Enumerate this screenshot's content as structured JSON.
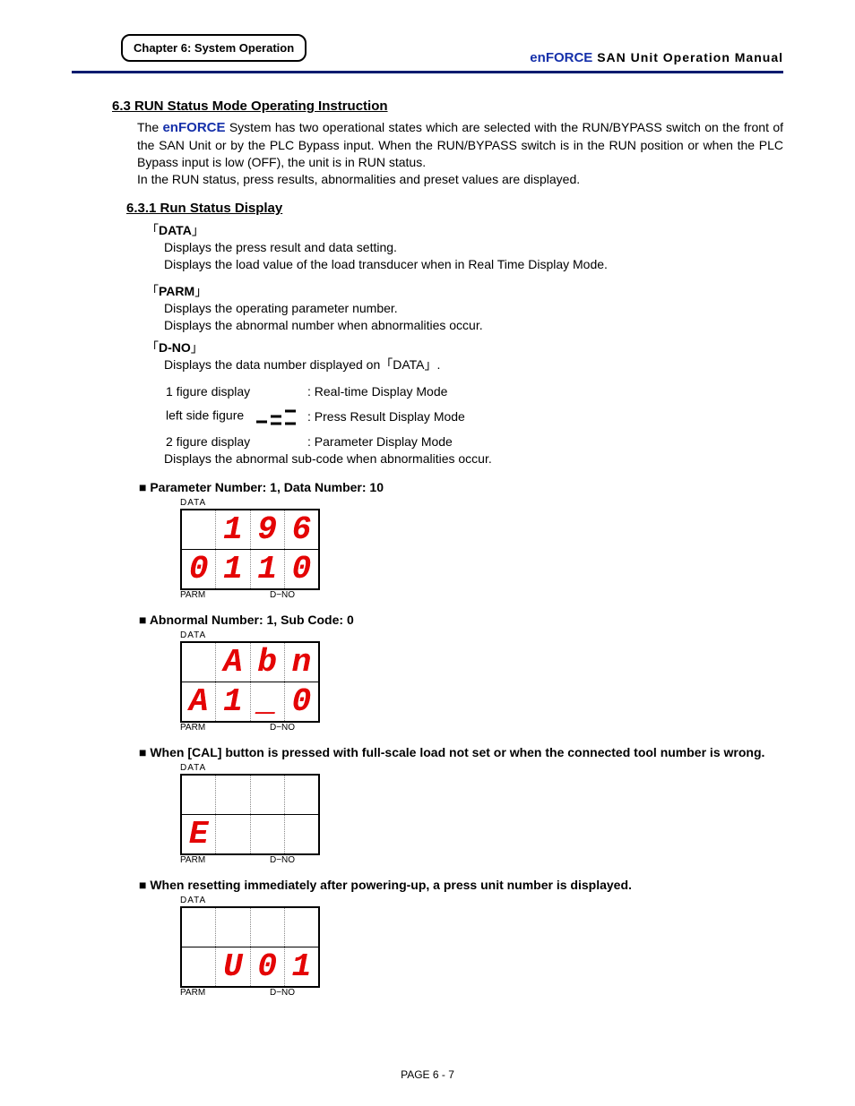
{
  "header": {
    "chapter": "Chapter 6: System Operation",
    "brand_lower": "en",
    "brand_upper": "FORCE",
    "manual": " SAN  Unit  Operation  Manual"
  },
  "section": {
    "h63": "6.3    RUN Status Mode Operating Instruction",
    "para1_a": "The ",
    "para1_b": " System has two operational states which are selected with the RUN/BYPASS switch on the front of the SAN Unit or by the PLC Bypass input. When the RUN/BYPASS switch is in the RUN position or when the PLC Bypass input is low (OFF), the unit is in RUN status.",
    "para1_c": "In the RUN status, press results, abnormalities and preset values are displayed.",
    "h631": "6.3.1    Run Status Display",
    "lbracket": "「",
    "rbracket": "」",
    "data_lbl": "DATA",
    "data_d1": "Displays the press result and data setting.",
    "data_d2": "Displays the load value of the load transducer when in Real Time Display Mode.",
    "parm_lbl": "PARM",
    "parm_d1": "Displays the operating parameter number.",
    "parm_d2": "Displays the abnormal number when abnormalities occur.",
    "dno_lbl": "D-NO",
    "dno_d1": "Displays the data number displayed on「DATA」.",
    "t1a": "1 figure display",
    "t1b": ": Real-time Display Mode",
    "t2a": "left side figure",
    "t2b": ": Press Result Display Mode",
    "t3a": "2 figure display",
    "t3b": ": Parameter Display Mode",
    "dno_d2": "Displays the abnormal sub-code when abnormalities occur."
  },
  "displays": {
    "label_data": "DATA",
    "label_parm": "PARM",
    "label_dno": "D−NO",
    "b1": "■ Parameter Number: 1, Data Number: 10",
    "d1_top": [
      "",
      "1",
      "9",
      "6"
    ],
    "d1_bot": [
      "0",
      "1",
      "1",
      "0"
    ],
    "b2": "■ Abnormal Number: 1, Sub Code: 0",
    "d2_top": [
      "",
      "A",
      "b",
      "n"
    ],
    "d2_bot": [
      "A",
      "1",
      "_",
      "0"
    ],
    "b3": "■ When [CAL] button is pressed with full-scale load not set or when the connected tool number is wrong.",
    "d3_top": [
      "",
      "",
      "",
      ""
    ],
    "d3_bot": [
      "E",
      "",
      "",
      ""
    ],
    "b4": "■ When resetting immediately after powering-up, a press unit number is displayed.",
    "d4_top": [
      "",
      "",
      "",
      ""
    ],
    "d4_bot": [
      "",
      "U",
      "0",
      "1"
    ]
  },
  "footer": "PAGE 6 - 7"
}
